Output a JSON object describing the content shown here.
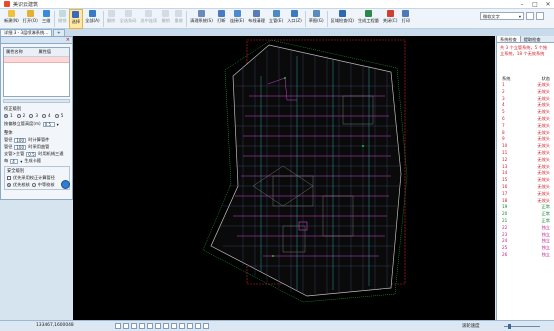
{
  "window": {
    "title": "美识云建筑",
    "min": "–",
    "max": "□",
    "close": "✕"
  },
  "toolbar": {
    "buttons": [
      {
        "label": "新建(N)",
        "color": "#f0c040",
        "enabled": true
      },
      {
        "label": "打开(O)",
        "color": "#e8b030",
        "enabled": true
      },
      {
        "label": "三维",
        "color": "#3a8ad8",
        "enabled": true
      },
      {
        "label": "撤销",
        "color": "#7aa",
        "enabled": false
      },
      {
        "label": "选择",
        "color": "#3a6ab8",
        "enabled": true,
        "active": true
      },
      {
        "label": "全部(A)",
        "color": "#3a78c8",
        "enabled": true
      },
      {
        "label": "删除",
        "color": "#aab",
        "enabled": false
      },
      {
        "label": "全选条码",
        "color": "#aab",
        "enabled": false
      },
      {
        "label": "选中连续",
        "color": "#aab",
        "enabled": false
      },
      {
        "label": "撤销",
        "color": "#aab",
        "enabled": false
      },
      {
        "label": "重做",
        "color": "#aab",
        "enabled": false
      },
      {
        "label": "清理系统(S)",
        "color": "#6a8ab8",
        "enabled": true
      },
      {
        "label": "打断",
        "color": "#4a7ac0",
        "enabled": true
      },
      {
        "label": "连接(E)",
        "color": "#4a8ad0",
        "enabled": true
      },
      {
        "label": "布线清理",
        "color": "#5a7ab8",
        "enabled": true
      },
      {
        "label": "立管(E)",
        "color": "#4a8ac8",
        "enabled": true
      },
      {
        "label": "入口(Z)",
        "color": "#3a7ac0",
        "enabled": true
      },
      {
        "label": "草图(G)",
        "color": "#5a8ac0",
        "enabled": true
      },
      {
        "label": "区域检查(Q)",
        "color": "#2a6ab0",
        "enabled": true
      },
      {
        "label": "生成工程量",
        "color": "#2a8a4a",
        "enabled": true
      },
      {
        "label": "关闭(C)",
        "color": "#d04030",
        "enabled": true
      },
      {
        "label": "打印",
        "color": "#4a7ab8",
        "enabled": true
      }
    ],
    "dropdown_value": "微软文字",
    "dropdown_arrow": "▾"
  },
  "tabs": [
    {
      "label": "详细 3 - 3层喷淋系统..."
    },
    {
      "label": "+"
    }
  ],
  "left_panel": {
    "close": "×",
    "table_headers": [
      "属性名称",
      "属性值"
    ],
    "calib": {
      "title": "校正级别",
      "options": [
        "1",
        "2",
        "3",
        "4",
        "5"
      ],
      "selected": 0,
      "height_label": "按偏移立管高度(m)",
      "height_value": "0.5"
    },
    "settings": {
      "title": "整体",
      "line1_label": "管径",
      "line1_value": "100",
      "line1_text": "时计算管件",
      "line2_label": "管径",
      "line2_value": "100",
      "line2_text": "时采用曲管",
      "line3_label": "支管>主管",
      "line3_value": "0.5",
      "line3_text": "时用机械三通",
      "line4_label": "每",
      "line4_value": "4",
      "line4_text": "生成卡箍"
    },
    "output": {
      "title": "安全级别",
      "check_label": "优先采用校正计算管径",
      "radio1": "优先校核",
      "radio2": "中等校核"
    }
  },
  "right_panel": {
    "tabs": [
      "系统检查",
      "提取检查"
    ],
    "message": "共 3 个立管系统，5 个独立系统，18 个无效系统",
    "col_left": "系统",
    "col_right": "状态",
    "rows": [
      {
        "n": "1",
        "s": "无效头",
        "t": "bad"
      },
      {
        "n": "2",
        "s": "无效头",
        "t": "bad"
      },
      {
        "n": "3",
        "s": "无效头",
        "t": "bad"
      },
      {
        "n": "4",
        "s": "无效头",
        "t": "bad"
      },
      {
        "n": "5",
        "s": "无效头",
        "t": "bad"
      },
      {
        "n": "6",
        "s": "无效头",
        "t": "bad"
      },
      {
        "n": "7",
        "s": "无效头",
        "t": "bad"
      },
      {
        "n": "8",
        "s": "无效头",
        "t": "bad"
      },
      {
        "n": "9",
        "s": "无效头",
        "t": "bad"
      },
      {
        "n": "10",
        "s": "无效头",
        "t": "bad"
      },
      {
        "n": "11",
        "s": "无效头",
        "t": "bad"
      },
      {
        "n": "12",
        "s": "无效头",
        "t": "bad"
      },
      {
        "n": "13",
        "s": "无效头",
        "t": "bad"
      },
      {
        "n": "14",
        "s": "无效头",
        "t": "bad"
      },
      {
        "n": "15",
        "s": "无效头",
        "t": "bad"
      },
      {
        "n": "16",
        "s": "无效头",
        "t": "bad"
      },
      {
        "n": "17",
        "s": "无效头",
        "t": "bad"
      },
      {
        "n": "18",
        "s": "无效头",
        "t": "bad"
      },
      {
        "n": "19",
        "s": "正常",
        "t": "ok"
      },
      {
        "n": "20",
        "s": "正常",
        "t": "ok"
      },
      {
        "n": "21",
        "s": "正常",
        "t": "ok"
      },
      {
        "n": "22",
        "s": "独立",
        "t": "mid"
      },
      {
        "n": "23",
        "s": "独立",
        "t": "mid"
      },
      {
        "n": "24",
        "s": "独立",
        "t": "mid"
      },
      {
        "n": "25",
        "s": "独立",
        "t": "mid"
      },
      {
        "n": "26",
        "s": "独立",
        "t": "mid"
      }
    ]
  },
  "status": {
    "coords": "133467,1600048",
    "speed": "滚轮速度"
  },
  "colors": {
    "canvas": "#000000",
    "boundary": "#c0c0c0",
    "pipes_magenta": "#d040d0",
    "pipes_green": "#20c040",
    "pipes_cyan": "#30c0c0",
    "frame_red": "#d02020"
  }
}
